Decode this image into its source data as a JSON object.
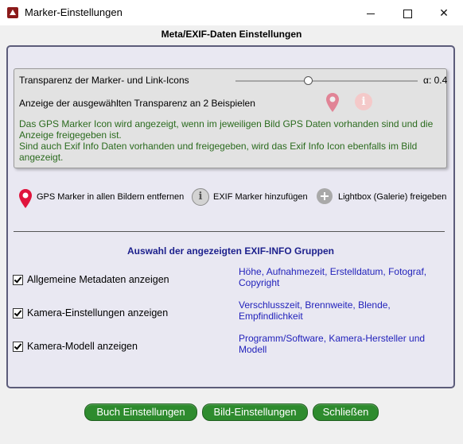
{
  "window": {
    "title": "Marker-Einstellungen",
    "controls": {
      "minimize": "",
      "maximize": "",
      "close": "✕"
    }
  },
  "header": {
    "title": "Meta/EXIF-Daten Einstellungen"
  },
  "transparency": {
    "label": "Transparenz der Marker- und Link-Icons",
    "alpha_label": "α: 0.4",
    "slider_value": 0.4,
    "example_label": "Anzeige der ausgewählten Transparenz an 2 Beispielen",
    "info_line1": "Das GPS Marker Icon wird angezeigt, wenn im jeweiligen Bild GPS Daten vorhanden sind und die Anzeige freigegeben ist.",
    "info_line2": "Sind auch Exif Info Daten vorhanden und freigegeben, wird das Exif Info Icon ebenfalls im Bild angezeigt."
  },
  "markers": {
    "gps_label": "GPS Marker in allen Bildern entfernen",
    "exif_label": "EXIF Marker hinzufügen",
    "lightbox_label": "Lightbox (Galerie) freigeben"
  },
  "exif_groups": {
    "title": "Auswahl der angezeigten EXIF-INFO Gruppen",
    "items": [
      {
        "label": "Allgemeine Metadaten anzeigen",
        "checked": true,
        "desc": "Höhe, Aufnahmezeit, Erstelldatum, Fotograf, Copyright"
      },
      {
        "label": "Kamera-Einstellungen anzeigen",
        "checked": true,
        "desc": "Verschlusszeit, Brennweite, Blende, Empfindlichkeit"
      },
      {
        "label": "Kamera-Modell anzeigen",
        "checked": true,
        "desc": "Programm/Software, Kamera-Hersteller und Modell"
      }
    ]
  },
  "footer": {
    "book_button": "Buch Einstellungen",
    "image_button": "Bild-Einstellungen",
    "close_button": "Schließen"
  },
  "colors": {
    "accent_green": "#2e8b2e",
    "info_text_green": "#2b6b1e",
    "group_title_blue": "#1b1f8c",
    "desc_blue": "#2222bb",
    "gps_red": "#e0143c"
  }
}
